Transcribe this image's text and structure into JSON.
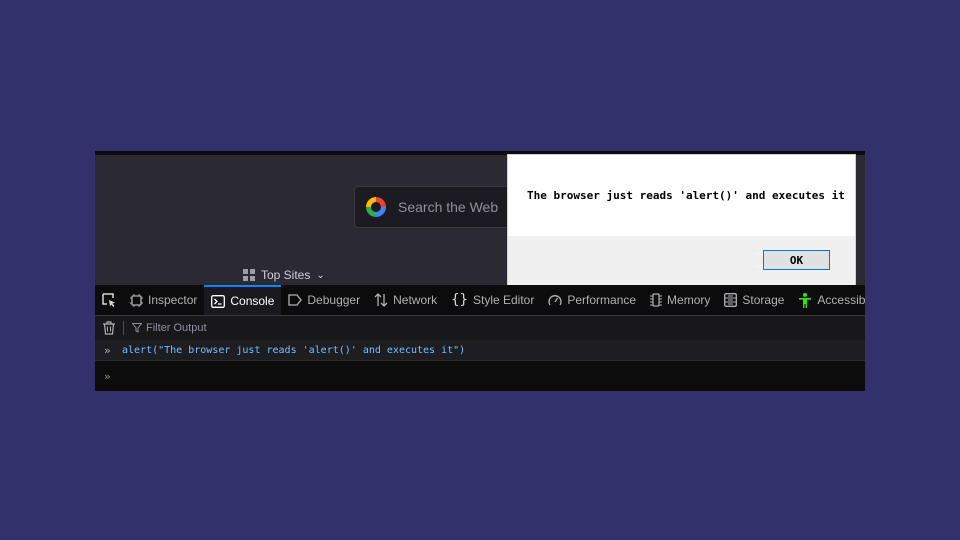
{
  "new_tab": {
    "search_placeholder": "Search the Web",
    "top_sites_label": "Top Sites"
  },
  "alert": {
    "message": "The browser just reads 'alert()' and executes it",
    "ok_label": "OK"
  },
  "devtools": {
    "tabs": [
      {
        "label": "Inspector",
        "icon": "inspector-icon"
      },
      {
        "label": "Console",
        "icon": "console-icon",
        "active": true
      },
      {
        "label": "Debugger",
        "icon": "debugger-icon"
      },
      {
        "label": "Network",
        "icon": "network-icon"
      },
      {
        "label": "Style Editor",
        "icon": "style-editor-icon"
      },
      {
        "label": "Performance",
        "icon": "performance-icon"
      },
      {
        "label": "Memory",
        "icon": "memory-icon"
      },
      {
        "label": "Storage",
        "icon": "storage-icon"
      },
      {
        "label": "Accessibility",
        "icon": "accessibility-icon"
      }
    ],
    "filter_placeholder": "Filter Output",
    "console_input": "alert(\"The browser just reads 'alert()' and executes it\")",
    "prompt_glyph": "»",
    "accent_color": "#0a84ff",
    "accessibility_color": "#30e60b"
  }
}
